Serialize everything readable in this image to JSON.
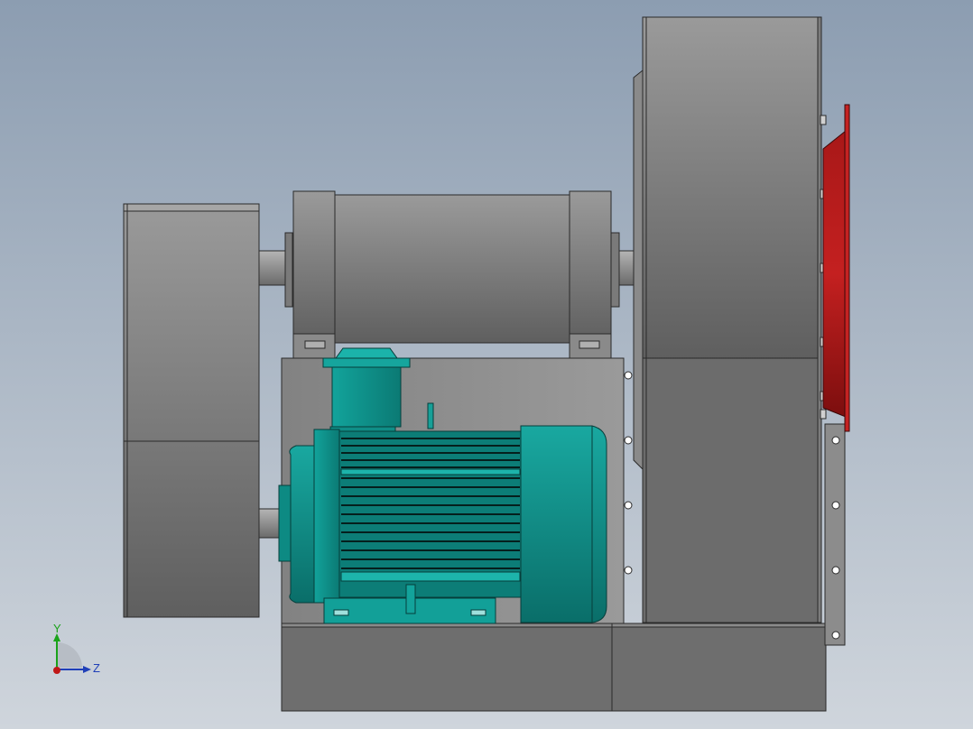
{
  "viewport": {
    "background_top": "#8c9db1",
    "background_bottom": "#cfd5dc"
  },
  "model": {
    "metal_color": "#6b6b6b",
    "motor_color": "#0f8d86",
    "inlet_color": "#b01717"
  },
  "triad": {
    "y_label": "Y",
    "z_label": "Z",
    "y_color": "#1aa31a",
    "z_color": "#1f3fb8",
    "x_color": "#c01818"
  }
}
